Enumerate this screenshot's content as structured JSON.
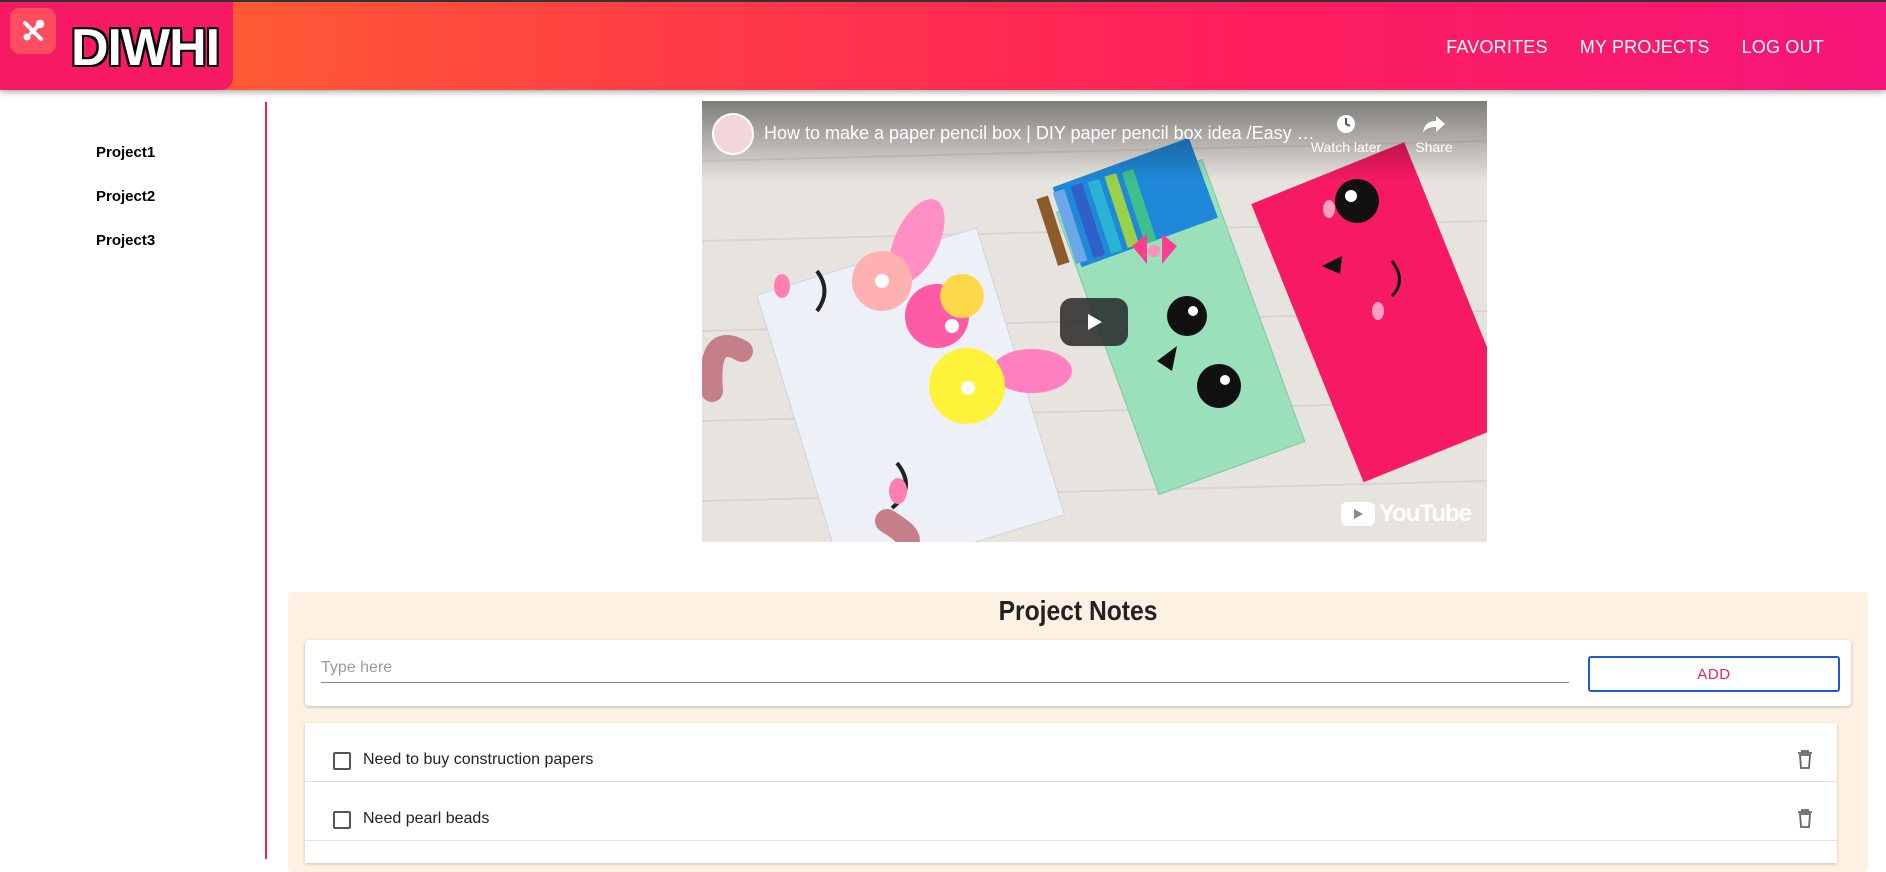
{
  "app": {
    "logo_text": "DIWHI"
  },
  "nav": {
    "items": [
      "FAVORITES",
      "MY PROJECTS",
      "LOG OUT"
    ]
  },
  "sidebar": {
    "items": [
      "Project1",
      "Project2",
      "Project3"
    ]
  },
  "video": {
    "title": "How to make a paper pencil box | DIY paper pencil box idea /Easy Origami pencil box",
    "watch_later_label": "Watch later",
    "share_label": "Share",
    "brand_label": "YouTube"
  },
  "notes": {
    "title": "Project Notes",
    "input_placeholder": "Type here",
    "add_label": "ADD",
    "items": [
      {
        "text": "Need to buy construction papers",
        "checked": false
      },
      {
        "text": "Need pearl beads",
        "checked": false
      }
    ]
  },
  "colors": {
    "accent": "#e8245e",
    "header_start": "#ff6a2a",
    "header_end": "#f5157a",
    "notes_bg": "#fdf1e3",
    "add_border": "#1e5ad6"
  }
}
